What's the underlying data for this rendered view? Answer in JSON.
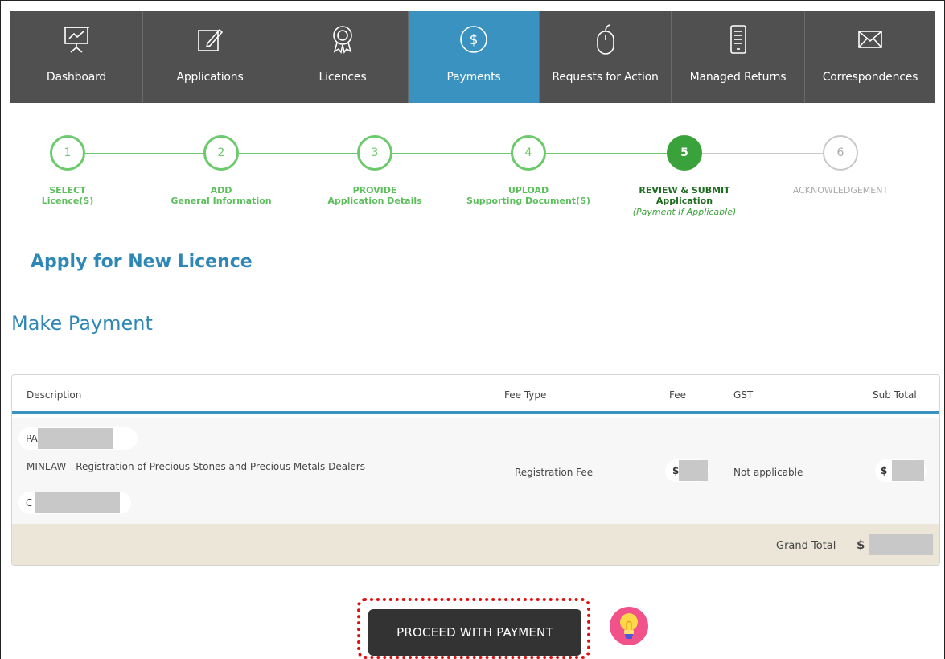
{
  "nav": {
    "items": [
      {
        "label": "Dashboard",
        "icon": "presentation-chart-icon",
        "active": false
      },
      {
        "label": "Applications",
        "icon": "edit-document-icon",
        "active": false
      },
      {
        "label": "Licences",
        "icon": "award-ribbon-icon",
        "active": false
      },
      {
        "label": "Payments",
        "icon": "dollar-circle-icon",
        "active": true
      },
      {
        "label": "Requests for Action",
        "icon": "mouse-icon",
        "active": false
      },
      {
        "label": "Managed Returns",
        "icon": "document-list-icon",
        "active": false
      },
      {
        "label": "Correspondences",
        "icon": "envelope-icon",
        "active": false
      }
    ]
  },
  "stepper": {
    "steps": [
      {
        "number": "1",
        "title": "SELECT",
        "subtitle": "Licence(S)",
        "note": "",
        "state": "done"
      },
      {
        "number": "2",
        "title": "ADD",
        "subtitle": "General Information",
        "note": "",
        "state": "done"
      },
      {
        "number": "3",
        "title": "PROVIDE",
        "subtitle": "Application Details",
        "note": "",
        "state": "done"
      },
      {
        "number": "4",
        "title": "UPLOAD",
        "subtitle": "Supporting Document(S)",
        "note": "",
        "state": "done"
      },
      {
        "number": "5",
        "title": "REVIEW & SUBMIT",
        "subtitle": "Application",
        "note": "(Payment If Applicable)",
        "state": "current"
      },
      {
        "number": "6",
        "title": "ACKNOWLEDGEMENT",
        "subtitle": "",
        "note": "",
        "state": "future"
      }
    ]
  },
  "page_title": "Apply for New Licence",
  "section_title": "Make Payment",
  "table": {
    "headers": {
      "description": "Description",
      "fee_type": "Fee Type",
      "fee": "Fee",
      "gst": "GST",
      "sub_total": "Sub Total"
    },
    "row": {
      "line1_prefix": "PA",
      "description": "MINLAW - Registration of Precious Stones and Precious Metals Dealers",
      "line3_prefix": "C",
      "fee_type": "Registration Fee",
      "fee_prefix": "$",
      "gst": "Not applicable",
      "sub_total_prefix": "$"
    },
    "footer": {
      "grand_total_label": "Grand Total",
      "grand_total_prefix": "$"
    }
  },
  "actions": {
    "proceed_label": "PROCEED WITH PAYMENT"
  },
  "colors": {
    "nav_bg": "#505050",
    "nav_active": "#3a92c0",
    "step_done": "#6cc96c",
    "step_current": "#3aa23a",
    "title_blue": "#2e87b5",
    "highlight_red": "#e01010"
  }
}
